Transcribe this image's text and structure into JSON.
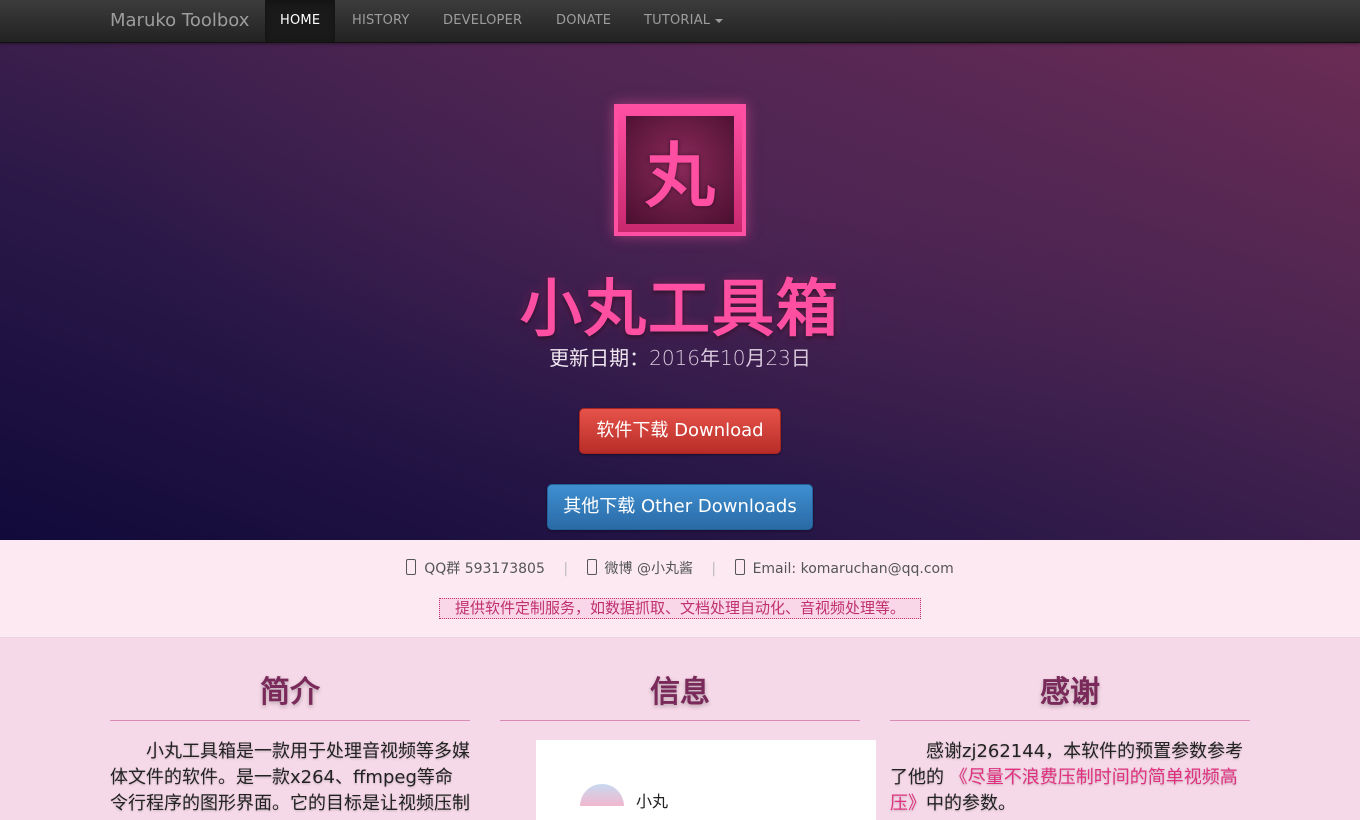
{
  "navbar": {
    "brand": "Maruko Toolbox",
    "items": [
      {
        "label": "HOME",
        "active": true
      },
      {
        "label": "HISTORY"
      },
      {
        "label": "DEVELOPER"
      },
      {
        "label": "DONATE"
      },
      {
        "label": "TUTORIAL"
      }
    ]
  },
  "hero": {
    "logo_char": "丸",
    "title": "小丸工具箱",
    "update_label": "更新日期：",
    "update_date": "2016年10月23日",
    "download_button": "软件下载 Download",
    "other_button": "其他下载 Other Downloads"
  },
  "contact": {
    "qq": "QQ群 593173805",
    "weibo": "微博 @小丸酱",
    "email": "Email: komaruchan@qq.com",
    "separator": "|",
    "service": "提供软件定制服务，如数据抓取、文档处理自动化、音视频处理等。"
  },
  "sections": {
    "intro": {
      "heading": "简介",
      "text": "小丸工具箱是一款用于处理音视频等多媒体文件的软件。是一款x264、ffmpeg等命令行程序的图形界面。它的目标是让视频压制"
    },
    "info": {
      "heading": "信息",
      "card_name": "小丸"
    },
    "thanks": {
      "heading": "感谢",
      "text_before": "感谢zj262144，本软件的预置参数参考了他的",
      "link": "《尽量不浪费压制时间的简单视频高压》",
      "text_after": "中的参数。"
    }
  },
  "colors": {
    "accent": "#ff4fa3",
    "download_button": "#d9403a",
    "other_button": "#337ab7",
    "navbar": "#2a2a2a"
  }
}
